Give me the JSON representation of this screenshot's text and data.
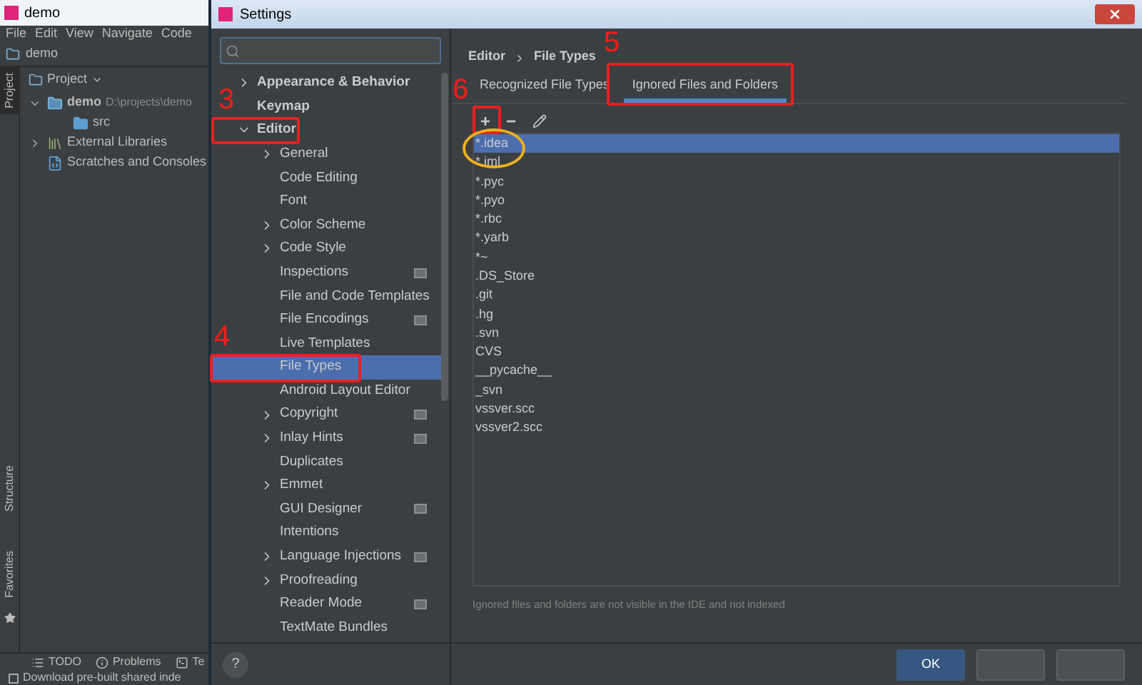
{
  "ide": {
    "title": "demo",
    "menu": [
      {
        "label": "File"
      },
      {
        "label": "Edit"
      },
      {
        "label": "View"
      },
      {
        "label": "Navigate"
      },
      {
        "label": "Code"
      }
    ],
    "breadcrumb": "demo",
    "side_tabs": [
      {
        "label": "Project",
        "selected": true
      },
      {
        "label": "Structure",
        "selected": false
      },
      {
        "label": "Favorites",
        "selected": false
      }
    ],
    "project_panel": {
      "title": "Project",
      "tree": [
        {
          "label": "demo",
          "path": "D:\\projects\\demo",
          "kind": "module",
          "expanded": true,
          "children": [
            {
              "label": "src",
              "kind": "folder"
            }
          ]
        },
        {
          "label": "External Libraries",
          "kind": "libraries",
          "expanded": false
        },
        {
          "label": "Scratches and Consoles",
          "kind": "scratches"
        }
      ]
    },
    "bottom_tabs": [
      {
        "label": "TODO",
        "kind": "list"
      },
      {
        "label": "Problems",
        "kind": "info"
      },
      {
        "label": "Te",
        "kind": "terminal"
      }
    ],
    "status_bar": {
      "text": "Download pre-built shared inde",
      "checked": false
    }
  },
  "settings": {
    "title": "Settings",
    "tree": [
      {
        "label": "Appearance & Behavior",
        "expandable": true,
        "expanded": false,
        "selected": false
      },
      {
        "label": "Keymap",
        "expandable": false,
        "selected": false
      },
      {
        "label": "Editor",
        "expandable": true,
        "expanded": true,
        "selected": false,
        "children": [
          {
            "label": "General",
            "expandable": true,
            "expanded": false,
            "project": false,
            "selected": false
          },
          {
            "label": "Code Editing",
            "expandable": false,
            "project": false,
            "selected": false
          },
          {
            "label": "Font",
            "expandable": false,
            "project": false,
            "selected": false
          },
          {
            "label": "Color Scheme",
            "expandable": true,
            "expanded": false,
            "project": false,
            "selected": false
          },
          {
            "label": "Code Style",
            "expandable": true,
            "expanded": false,
            "project": false,
            "selected": false
          },
          {
            "label": "Inspections",
            "expandable": false,
            "project": true,
            "selected": false
          },
          {
            "label": "File and Code Templates",
            "expandable": false,
            "project": false,
            "selected": false
          },
          {
            "label": "File Encodings",
            "expandable": false,
            "project": true,
            "selected": false
          },
          {
            "label": "Live Templates",
            "expandable": false,
            "project": false,
            "selected": false
          },
          {
            "label": "File Types",
            "expandable": false,
            "project": false,
            "selected": true
          },
          {
            "label": "Android Layout Editor",
            "expandable": false,
            "project": false,
            "selected": false
          },
          {
            "label": "Copyright",
            "expandable": true,
            "expanded": false,
            "project": true,
            "selected": false
          },
          {
            "label": "Inlay Hints",
            "expandable": true,
            "expanded": false,
            "project": true,
            "selected": false
          },
          {
            "label": "Duplicates",
            "expandable": false,
            "project": false,
            "selected": false
          },
          {
            "label": "Emmet",
            "expandable": true,
            "expanded": false,
            "project": false,
            "selected": false
          },
          {
            "label": "GUI Designer",
            "expandable": false,
            "project": true,
            "selected": false
          },
          {
            "label": "Intentions",
            "expandable": false,
            "project": false,
            "selected": false
          },
          {
            "label": "Language Injections",
            "expandable": true,
            "expanded": false,
            "project": true,
            "selected": false
          },
          {
            "label": "Proofreading",
            "expandable": true,
            "expanded": false,
            "project": false,
            "selected": false
          },
          {
            "label": "Reader Mode",
            "expandable": false,
            "project": true,
            "selected": false
          },
          {
            "label": "TextMate Bundles",
            "expandable": false,
            "project": false,
            "selected": false
          }
        ]
      }
    ],
    "help": "?",
    "breadcrumb": [
      "Editor",
      "File Types"
    ],
    "tabs": [
      {
        "label": "Recognized File Types",
        "selected": false
      },
      {
        "label": "Ignored Files and Folders",
        "selected": true
      }
    ],
    "toolbar": [
      {
        "kind": "add",
        "label": "+"
      },
      {
        "kind": "remove",
        "label": "−"
      },
      {
        "kind": "edit"
      }
    ],
    "patterns": [
      {
        "label": "*.idea",
        "selected": true
      },
      {
        "label": "*.iml",
        "selected": false
      },
      {
        "label": "*.pyc",
        "selected": false
      },
      {
        "label": "*.pyo",
        "selected": false
      },
      {
        "label": "*.rbc",
        "selected": false
      },
      {
        "label": "*.yarb",
        "selected": false
      },
      {
        "label": "*~",
        "selected": false
      },
      {
        "label": ".DS_Store",
        "selected": false
      },
      {
        "label": ".git",
        "selected": false
      },
      {
        "label": ".hg",
        "selected": false
      },
      {
        "label": ".svn",
        "selected": false
      },
      {
        "label": "CVS",
        "selected": false
      },
      {
        "label": "__pycache__",
        "selected": false
      },
      {
        "label": "_svn",
        "selected": false
      },
      {
        "label": "vssver.scc",
        "selected": false
      },
      {
        "label": "vssver2.scc",
        "selected": false
      }
    ],
    "hint": "Ignored files and folders are not visible in the IDE and not indexed",
    "buttons": [
      {
        "label": "OK",
        "kind": "primary"
      }
    ]
  },
  "annotations": [
    {
      "label": "3",
      "kind": "number"
    },
    {
      "label": "4",
      "kind": "number"
    },
    {
      "label": "5",
      "kind": "number"
    },
    {
      "label": "6",
      "kind": "number"
    }
  ]
}
